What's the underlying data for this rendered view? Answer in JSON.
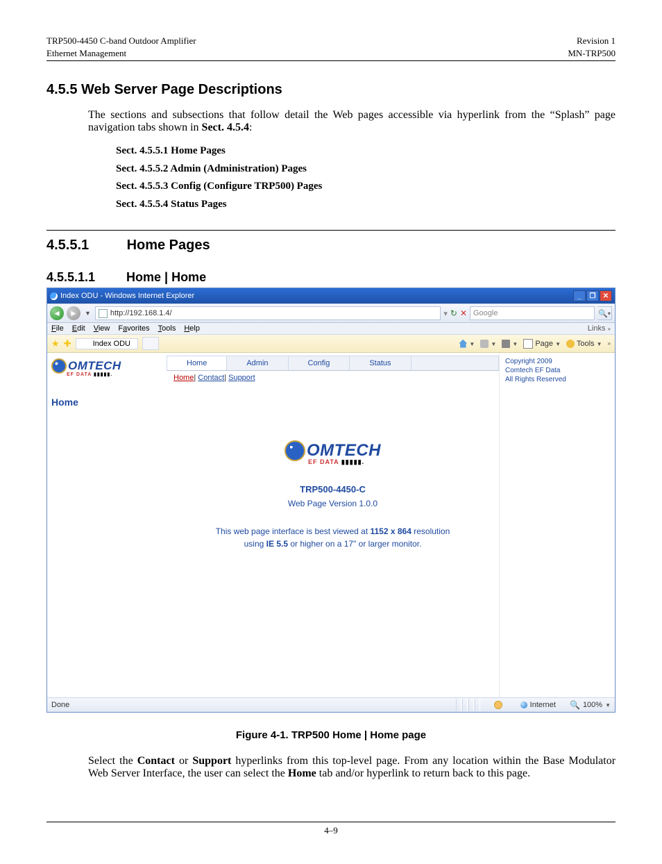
{
  "doc": {
    "header_left_line1": "TRP500-4450 C-band Outdoor Amplifier",
    "header_left_line2": "Ethernet Management",
    "header_right_line1": "Revision 1",
    "header_right_line2": "MN-TRP500",
    "section_4_5_5": "4.5.5 Web Server Page Descriptions",
    "intro_para": "The sections and subsections that follow detail the Web pages accessible via hyperlink from the “Splash” page navigation tabs shown in ",
    "intro_bold": "Sect. 4.5.4",
    "intro_colon": ":",
    "toc1": "Sect. 4.5.5.1  Home Pages",
    "toc2": "Sect. 4.5.5.2  Admin (Administration) Pages",
    "toc3": "Sect. 4.5.5.3  Config (Configure TRP500) Pages",
    "toc4": "Sect. 4.5.5.4  Status Pages",
    "h_4_5_5_1_num": "4.5.5.1",
    "h_4_5_5_1_title": "Home Pages",
    "h_4_5_5_1_1_num": "4.5.5.1.1",
    "h_4_5_5_1_1_title": "Home | Home",
    "figure_caption": "Figure 4-1. TRP500 Home | Home page",
    "closing_para_pre": "Select the ",
    "closing_bold1": "Contact",
    "closing_mid1": " or ",
    "closing_bold2": "Support",
    "closing_mid2": " hyperlinks from this top-level page. From any location within the Base Modulator Web Server Interface, the user can select the ",
    "closing_bold3": "Home",
    "closing_end": " tab and/or hyperlink to return back to this page.",
    "page_number": "4–9"
  },
  "browser": {
    "window_title": "Index ODU - Windows Internet Explorer",
    "address": "http://192.168.1.4/",
    "search_placeholder": "Google",
    "menus": {
      "file": "File",
      "edit": "Edit",
      "view": "View",
      "favorites": "Favorites",
      "tools": "Tools",
      "help": "Help"
    },
    "links_label": "Links",
    "tab_label": "Index ODU",
    "toolbar": {
      "page": "Page",
      "tools": "Tools"
    },
    "tabs": {
      "home": "Home",
      "admin": "Admin",
      "config": "Config",
      "status": "Status"
    },
    "subnav": {
      "home": "Home",
      "contact": "Contact",
      "support": "Support"
    },
    "rightcol": {
      "line1": "Copyright 2009",
      "line2": "Comtech EF Data",
      "line3": "All Rights Reserved"
    },
    "left": {
      "home_label": "Home"
    },
    "center": {
      "logo_text": "OMTECH",
      "logo_sub": "EF DATA",
      "model": "TRP500-4450-C",
      "version": "Web Page Version 1.0.0",
      "note_pre": "This web page interface is best viewed at ",
      "note_bold1": "1152 x 864",
      "note_mid": " resolution",
      "note_line2_pre": "using ",
      "note_line2_bold": "IE 5.5",
      "note_line2_end": " or higher on a 17\" or larger monitor."
    },
    "status": {
      "done": "Done",
      "zone": "Internet",
      "zoom": "100%"
    }
  }
}
